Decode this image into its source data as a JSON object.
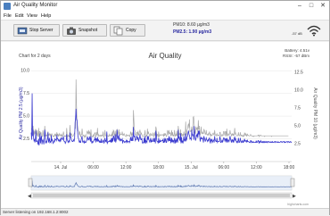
{
  "window": {
    "title": "Air Quality Monitor"
  },
  "menu": [
    "File",
    "Edit",
    "View",
    "Help"
  ],
  "toolbar": {
    "stop_server": "Stop Server",
    "snapshot": "Snapshot",
    "copy": "Copy"
  },
  "readouts": {
    "pm10": "PM10: 8.60 µg/m3",
    "pm25": "PM2.5: 1.90 µg/m3"
  },
  "wifi": {
    "rssi": "-57 dB"
  },
  "status": {
    "text": "Server listening on 192.168.1.2:8002"
  },
  "chart": {
    "title": "Air Quality",
    "subtitle": "Chart for 2 days",
    "battery": "Battery: 4.51v",
    "rssi": "RSSI: -57 dBm",
    "credit": "highcharts.com",
    "left_axis_label": "Air Quality PM 2.5 (µg/m3)",
    "right_axis_label": "Air Quality PM 10 (µg/m3)",
    "x_ticks": [
      "14. Jul",
      "06:00",
      "12:00",
      "18:00",
      "15. Jul",
      "06:00",
      "12:00",
      "18:00"
    ],
    "left_ticks": [
      "2.5",
      "5.0",
      "7.5",
      "10.0"
    ],
    "right_ticks": [
      "2.5",
      "5.0",
      "7.5",
      "10.0",
      "12.5"
    ],
    "colors": {
      "pm25": "#3a3acf",
      "pm10": "#a9a9a9",
      "grid": "#e6e6e6",
      "navigator_fill": "#dbe4f3"
    }
  },
  "chart_data": {
    "type": "line",
    "title": "Air Quality",
    "subtitle": "Chart for 2 days",
    "x_label": "",
    "y_label_left": "Air Quality PM 2.5 (µg/m3)",
    "y_label_right": "Air Quality PM 10 (µg/m3)",
    "x_ticks": [
      "14. Jul",
      "06:00",
      "12:00",
      "18:00",
      "15. Jul",
      "06:00",
      "12:00",
      "18:00"
    ],
    "ylim_left": [
      0,
      11
    ],
    "ylim_right": [
      0,
      14
    ],
    "grid": true,
    "series": [
      {
        "axis": "left",
        "values": [
          3.2,
          2.4,
          7.5,
          2.8,
          3.5,
          2.6,
          2.3,
          2.4,
          2.1,
          2.5,
          3.4,
          2.2,
          2.2,
          2.3,
          2.0,
          1.9,
          2.5,
          1.8,
          2.6,
          3.1,
          2.0,
          2.5,
          2.8,
          1.9,
          2.3,
          2.4,
          2.2,
          1.9,
          2.4,
          3.5,
          3.2,
          2.0,
          2.2,
          2.1,
          2.3,
          2.5,
          3.2,
          2.1,
          2.3,
          2.6,
          2.1,
          2.2,
          2.1,
          2.9,
          2.3,
          2.4,
          2.2,
          2.0,
          2.1,
          2.3,
          2.2,
          2.5,
          2.4,
          2.4,
          2.3,
          2.9,
          2.5,
          2.5,
          2.3,
          2.4,
          2.3,
          2.2,
          2.5,
          2.2,
          2.6,
          2.6,
          2.5,
          2.4,
          2.5,
          2.8,
          2.3,
          2.2,
          2.2,
          2.0,
          2.1,
          2.3,
          3.0,
          2.4,
          2.3,
          2.1,
          2.2,
          2.3,
          2.1,
          3.2,
          2.7,
          2.7,
          2.4,
          2.3,
          2.2,
          2.2,
          2.3,
          2.4,
          2.2,
          2.6,
          4.3,
          4.8,
          5.8,
          4.6,
          4.6,
          3.5,
          2.8,
          2.6,
          2.4,
          2.1,
          2.3,
          2.1,
          2.1,
          2.4,
          2.6,
          2.8,
          2.2,
          2.1,
          2.2,
          2.3,
          2.0,
          2.2,
          2.1,
          2.1,
          2.2,
          2.4,
          2.6,
          2.7,
          2.4,
          2.5,
          2.4,
          2.7,
          2.6,
          2.2,
          2.8,
          2.3,
          2.0,
          2.2,
          2.1,
          2.2,
          2.3,
          2.4,
          2.4,
          2.7,
          2.1,
          2.5,
          2.5,
          2.2,
          2.7,
          2.2,
          2.4,
          2.3,
          2.1,
          2.3,
          2.1,
          2.1,
          2.5,
          2.1,
          2.1,
          2.2,
          2.4,
          2.2,
          2.0,
          2.3,
          2.6,
          2.2,
          2.3,
          2.2,
          3.3,
          2.0,
          2.1,
          2.2,
          2.2,
          2.2,
          2.3,
          2.2,
          2.4,
          2.1,
          2.6,
          2.1,
          2.6,
          2.2,
          2.8,
          2.8,
          2.4,
          2.2,
          3.0,
          2.1,
          2.3,
          2.6,
          3.5,
          2.6,
          2.4,
          2.8,
          2.9,
          2.3,
          2.6,
          2.3,
          2.4,
          2.3,
          2.4,
          2.5,
          2.0,
          2.3,
          2.3,
          2.2,
          2.1,
          2.2,
          2.2,
          2.1,
          2.4,
          2.2,
          2.3,
          2.1,
          2.2,
          2.2,
          2.2,
          2.1,
          2.4,
          2.7,
          2.3,
          2.3,
          2.8,
          2.3,
          2.3,
          3.8,
          2.8,
          2.7,
          2.8,
          2.3,
          2.4,
          2.4,
          2.8,
          2.7,
          2.4,
          2.7,
          2.2,
          2.4,
          2.6,
          3.0,
          2.6,
          2.4,
          2.4,
          2.6,
          2.1,
          2.0,
          2.1,
          2.1,
          2.6,
          2.0,
          2.8,
          2.0,
          2.3,
          2.2,
          2.1,
          2.8,
          2.4,
          2.8,
          2.4,
          2.3,
          2.1,
          2.3,
          2.6,
          2.1,
          2.4,
          2.2,
          2.2,
          2.4,
          2.6,
          2.2,
          2.2,
          2.6,
          2.0,
          3.4,
          3.0,
          2.3,
          2.2,
          2.2,
          2.0,
          2.6,
          2.1,
          2.1,
          2.4,
          2.2,
          2.2,
          2.3,
          2.3,
          2.3,
          2.4,
          2.1,
          2.1,
          2.6,
          2.1,
          2.4,
          2.5,
          2.1,
          2.1,
          2.5,
          2.5,
          2.5,
          2.2,
          2.8,
          2.3,
          2.3,
          2.7,
          2.1,
          2.2,
          2.6,
          2.1,
          2.4,
          2.2,
          2.3,
          2.0,
          2.6,
          2.4,
          2.0,
          2.4,
          2.1,
          2.6,
          2.3,
          2.1,
          3.5,
          2.6,
          2.7,
          2.4,
          2.3,
          3.1,
          2.0,
          2.7,
          2.1,
          2.3,
          2.0,
          2.3,
          2.8,
          2.3,
          2.4,
          2.3,
          3.1,
          2.3,
          2.4,
          2.7,
          2.8,
          3.2,
          3.4,
          3.0,
          2.9,
          2.5,
          2.6,
          2.5,
          2.4,
          3.5,
          3.0,
          2.8,
          3.0,
          2.4,
          3.9,
          3.2,
          2.6,
          2.3,
          2.5,
          2.9,
          2.8,
          3.1,
          2.6,
          3.4,
          3.0,
          3.4,
          2.8,
          2.2,
          2.5,
          2.7,
          2.5,
          2.5,
          2.6,
          2.4,
          2.1,
          2.8,
          2.6,
          2.4,
          2.2,
          2.4,
          2.6,
          2.4,
          2.3,
          2.2,
          2.4,
          2.3,
          2.5,
          2.6,
          2.2,
          2.0,
          2.5,
          2.3,
          2.4,
          2.1,
          2.2,
          2.4,
          2.3,
          2.1,
          2.8,
          2.4,
          2.3,
          2.2,
          2.2,
          2.6,
          2.1,
          2.2,
          2.2,
          2.2,
          2.2,
          2.7,
          2.6,
          2.1,
          2.1,
          2.2,
          2.4,
          2.1,
          2.3,
          2.6,
          2.6,
          2.5,
          2.2,
          2.5,
          2.5,
          2.1,
          2.6,
          2.3,
          2.1,
          2.4,
          2.3,
          2.2,
          2.5,
          2.8,
          2.5,
          2.3,
          2.1,
          2.4,
          2.4,
          2.1,
          2.4,
          2.1,
          2.6,
          2.7,
          2.3,
          2.5,
          2.3,
          2.1,
          2.2,
          2.1,
          2.3,
          2.6,
          2.1,
          2.1,
          2.3,
          2.6,
          2.2,
          2.1,
          2.2,
          2.3,
          2.1,
          2.1,
          2.3,
          2.2,
          2.5,
          2.3,
          2.2,
          2.3,
          2.3,
          2.1,
          2.4,
          2.2,
          2.2,
          2.2,
          2.1,
          2.1,
          2.1,
          2.3,
          2.3,
          2.1,
          2.2,
          2.1,
          2.1,
          2.2,
          2.1,
          2.1,
          2.1,
          2.1,
          2.1,
          2.3,
          2.1,
          2.1,
          2.2,
          2.3,
          2.3,
          2.0,
          2.2,
          2.1,
          2.2,
          2.3,
          2.1,
          2.1,
          2.2,
          2.1,
          2.2,
          2.1,
          2.2,
          2.1,
          2.2,
          2.1,
          2.1,
          2.2,
          2.1,
          2.2,
          2.2,
          2.1,
          2.2,
          2.2,
          2.1,
          2.1,
          2.1,
          2.2,
          2.1,
          2.1,
          2.2,
          2.1,
          2.1,
          2.1,
          2.2,
          2.2,
          2.1,
          2.2,
          2.2,
          2.1,
          2.1,
          2.1,
          2.2,
          2.1,
          2.1,
          2.1,
          2.1,
          2.2,
          2.2,
          2.2,
          2.1,
          2.1,
          2.2,
          2.2,
          2.2,
          2.1,
          2.2,
          2.1,
          2.1,
          2.1,
          2.2,
          2.2,
          2.2,
          2.1,
          2.2,
          2.2,
          2.1,
          2.1,
          2.2,
          2.2,
          2.1,
          2.1
        ]
      },
      {
        "axis": "right",
        "values": [
          4.5,
          4.6,
          4.4,
          4.8,
          5.0,
          4.1,
          3.7,
          4.3,
          3.9,
          4.5,
          4.5,
          3.9,
          3.6,
          4.4,
          3.7,
          3.4,
          4.7,
          3.5,
          4.2,
          4.2,
          3.9,
          4.1,
          3.6,
          3.5,
          3.5,
          4.4,
          3.9,
          3.5,
          3.7,
          5.0,
          4.1,
          3.5,
          3.7,
          3.7,
          3.6,
          4.0,
          4.2,
          3.6,
          3.8,
          3.9,
          3.6,
          3.9,
          3.4,
          3.8,
          3.9,
          3.7,
          3.6,
          3.5,
          3.6,
          3.5,
          3.7,
          3.9,
          3.5,
          3.8,
          3.6,
          4.1,
          3.6,
          3.9,
          3.5,
          3.7,
          3.9,
          3.6,
          3.6,
          3.8,
          3.6,
          3.8,
          3.5,
          3.7,
          3.7,
          4.2,
          3.8,
          3.6,
          3.5,
          3.6,
          3.5,
          3.5,
          4.7,
          3.8,
          3.4,
          3.7,
          3.6,
          3.5,
          3.6,
          5.1,
          4.1,
          3.6,
          3.9,
          3.8,
          3.5,
          3.6,
          3.6,
          3.7,
          3.9,
          4.1,
          4.8,
          4.6,
          11.5,
          7.9,
          5.8,
          5.2,
          4.7,
          4.3,
          4.2,
          3.7,
          4.2,
          3.7,
          3.4,
          3.8,
          3.8,
          4.6,
          3.9,
          3.6,
          3.7,
          3.6,
          3.4,
          3.7,
          3.5,
          3.4,
          3.5,
          4.0,
          4.3,
          4.0,
          3.9,
          4.4,
          3.8,
          4.2,
          4.0,
          3.4,
          4.5,
          3.6,
          3.6,
          3.5,
          3.4,
          3.8,
          3.5,
          3.9,
          3.9,
          4.1,
          3.4,
          3.6,
          4.1,
          3.7,
          4.7,
          3.6,
          3.8,
          3.5,
          3.6,
          3.7,
          3.7,
          3.5,
          3.7,
          3.6,
          3.7,
          3.6,
          4.2,
          3.6,
          3.4,
          3.6,
          4.4,
          3.7,
          3.6,
          3.5,
          4.0,
          3.6,
          3.6,
          3.6,
          3.5,
          3.8,
          3.6,
          3.6,
          3.7,
          3.6,
          3.8,
          3.5,
          4.2,
          3.6,
          4.4,
          4.3,
          3.6,
          3.8,
          4.3,
          3.5,
          3.6,
          4.4,
          4.5,
          4.0,
          3.8,
          4.2,
          4.5,
          3.7,
          4.1,
          3.7,
          3.8,
          3.8,
          3.8,
          4.2,
          3.7,
          3.8,
          3.7,
          3.9,
          3.7,
          3.6,
          3.6,
          3.5,
          3.8,
          3.7,
          3.6,
          3.7,
          3.6,
          3.6,
          3.7,
          3.5,
          3.7,
          4.2,
          3.9,
          3.6,
          4.1,
          3.7,
          3.6,
          7.2,
          5.8,
          4.4,
          4.4,
          3.8,
          3.8,
          3.7,
          4.1,
          4.1,
          3.6,
          4.3,
          3.7,
          3.8,
          4.2,
          4.4,
          4.1,
          3.8,
          4.0,
          3.8,
          3.6,
          3.5,
          3.5,
          3.5,
          3.8,
          3.8,
          4.4,
          3.4,
          3.6,
          3.7,
          3.5,
          4.6,
          3.8,
          4.2,
          3.9,
          3.8,
          3.5,
          3.7,
          4.0,
          3.7,
          3.8,
          3.7,
          3.6,
          4.0,
          3.9,
          3.5,
          3.6,
          4.1,
          3.7,
          4.9,
          4.6,
          3.5,
          3.8,
          3.8,
          3.4,
          4.2,
          3.5,
          3.6,
          3.8,
          3.7,
          3.7,
          3.7,
          3.8,
          3.7,
          3.7,
          3.8,
          3.5,
          4.0,
          3.6,
          3.8,
          3.9,
          3.6,
          3.5,
          3.8,
          4.4,
          4.2,
          3.7,
          4.4,
          3.9,
          3.9,
          4.1,
          3.6,
          3.7,
          4.4,
          3.6,
          4.1,
          3.6,
          3.7,
          3.5,
          4.4,
          3.8,
          3.5,
          3.8,
          3.6,
          4.3,
          3.6,
          3.5,
          5.0,
          4.4,
          3.7,
          3.9,
          3.7,
          4.5,
          3.6,
          4.0,
          3.5,
          3.8,
          3.8,
          3.6,
          4.2,
          3.7,
          3.8,
          3.7,
          5.6,
          3.6,
          3.9,
          4.4,
          4.6,
          5.1,
          5.3,
          4.7,
          5.9,
          4.2,
          4.3,
          4.2,
          4.3,
          4.9,
          4.3,
          4.5,
          6.2,
          6.3,
          5.5,
          4.6,
          4.1,
          3.9,
          4.9,
          4.5,
          4.6,
          4.8,
          4.0,
          5.8,
          4.5,
          5.0,
          4.2,
          3.7,
          4.1,
          4.9,
          4.0,
          3.9,
          4.2,
          3.9,
          3.9,
          4.5,
          4.4,
          4.1,
          3.8,
          3.9,
          4.4,
          3.8,
          3.8,
          3.7,
          3.9,
          3.7,
          3.9,
          4.2,
          3.8,
          3.6,
          3.9,
          3.6,
          3.7,
          3.7,
          3.9,
          4.0,
          3.8,
          3.7,
          4.4,
          3.8,
          3.7,
          3.6,
          3.8,
          3.9,
          3.6,
          3.7,
          3.7,
          3.7,
          3.6,
          4.1,
          4.1,
          3.6,
          3.5,
          3.7,
          3.8,
          3.6,
          3.6,
          4.2,
          4.2,
          3.9,
          3.6,
          4.2,
          4.2,
          3.5,
          4.6,
          3.7,
          3.6,
          3.9,
          3.9,
          3.7,
          3.9,
          4.4,
          3.9,
          3.9,
          3.6,
          3.8,
          3.9,
          3.6,
          3.9,
          3.6,
          3.9,
          4.7,
          3.8,
          4.0,
          3.8,
          3.6,
          3.6,
          3.6,
          3.7,
          4.1,
          3.6,
          3.6,
          3.7,
          4.1,
          3.6,
          3.7,
          3.6,
          3.7,
          3.5,
          3.5,
          3.7,
          3.5,
          4.0,
          3.9,
          3.6,
          3.9,
          3.7,
          3.5,
          3.9,
          3.7,
          3.7,
          3.6,
          3.6,
          3.6,
          3.6,
          3.8,
          3.7,
          3.6,
          3.6,
          3.5,
          3.6,
          3.6,
          3.5,
          3.6,
          3.6,
          3.6,
          3.6,
          3.6,
          3.6,
          3.6,
          3.6,
          3.7,
          3.7,
          3.5,
          3.7,
          3.6,
          3.6,
          3.7,
          3.6,
          3.6,
          3.6,
          3.6,
          3.6,
          3.6,
          3.6,
          3.5,
          3.6,
          3.6,
          3.6,
          3.6,
          3.6,
          3.6,
          3.6,
          3.6,
          3.6,
          3.6,
          3.6,
          3.6,
          3.6,
          3.6,
          3.5,
          3.6,
          3.6,
          3.6,
          3.6,
          3.6,
          3.6,
          3.6,
          3.6,
          3.6,
          3.6,
          3.6,
          3.6,
          3.6,
          3.6,
          3.6,
          3.6,
          3.6,
          3.6,
          3.6,
          3.6,
          3.6,
          3.6,
          3.6,
          3.6,
          3.6,
          3.6,
          3.6,
          3.6,
          3.6,
          3.6,
          3.6,
          3.6,
          3.6,
          3.6,
          3.6,
          3.6
        ]
      }
    ]
  }
}
